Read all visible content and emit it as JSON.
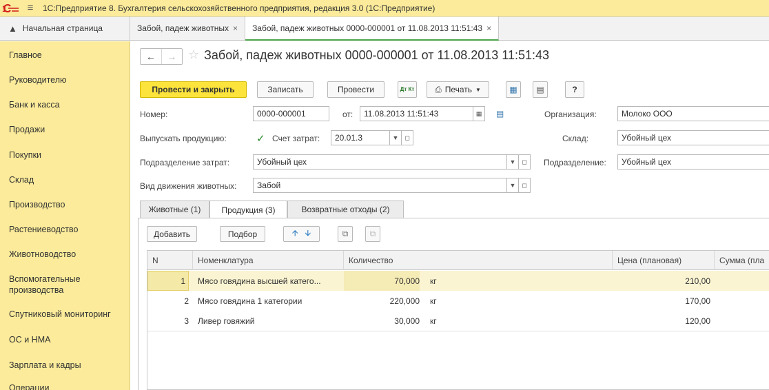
{
  "window": {
    "title": "1С:Предприятие 8. Бухгалтерия сельскохозяйственного предприятия, редакция 3.0  (1С:Предприятие)"
  },
  "tabs": [
    {
      "label": "Начальная страница"
    },
    {
      "label": "Забой, падеж животных",
      "close": "×"
    },
    {
      "label": "Забой, падеж животных 0000-000001 от 11.08.2013 11:51:43",
      "close": "×"
    }
  ],
  "sidebar": {
    "items": [
      {
        "label": "Главное"
      },
      {
        "label": "Руководителю"
      },
      {
        "label": "Банк и касса"
      },
      {
        "label": "Продажи"
      },
      {
        "label": "Покупки"
      },
      {
        "label": "Склад"
      },
      {
        "label": "Производство"
      },
      {
        "label": "Растениеводство"
      },
      {
        "label": "Животноводство"
      },
      {
        "label": "Вспомогательные производства"
      },
      {
        "label": "Спутниковый мониторинг"
      },
      {
        "label": "ОС и НМА"
      },
      {
        "label": "Зарплата и кадры"
      },
      {
        "label": "Операции"
      }
    ]
  },
  "document": {
    "title": "Забой, падеж животных 0000-000001 от 11.08.2013 11:51:43"
  },
  "toolbar": {
    "post_close": "Провести и закрыть",
    "save": "Записать",
    "post": "Провести",
    "dtkt": "Дт Кт",
    "print": "Печать",
    "help": "?"
  },
  "form": {
    "number_label": "Номер:",
    "number_value": "0000-000001",
    "date_label": "от:",
    "date_value": "11.08.2013 11:51:43",
    "org_label": "Организация:",
    "org_value": "Молоко ООО",
    "produce_label": "Выпускать продукцию:",
    "produce_checked": true,
    "cost_account_label": "Счет затрат:",
    "cost_account_value": "20.01.3",
    "warehouse_label": "Склад:",
    "warehouse_value": "Убойный цех",
    "cost_dept_label": "Подразделение затрат:",
    "cost_dept_value": "Убойный цех",
    "dept_label": "Подразделение:",
    "dept_value": "Убойный цех",
    "movement_label": "Вид движения животных:",
    "movement_value": "Забой"
  },
  "inner_tabs": [
    {
      "label": "Животные (1)"
    },
    {
      "label": "Продукция (3)"
    },
    {
      "label": "Возвратные отходы (2)"
    }
  ],
  "table_toolbar": {
    "add": "Добавить",
    "pick": "Подбор"
  },
  "table": {
    "columns": [
      "N",
      "Номенклатура",
      "Количество",
      "Цена (плановая)",
      "Сумма (пла"
    ],
    "rows": [
      {
        "n": "1",
        "item": "Мясо говядина высшей катего...",
        "qty": "70,000",
        "unit": "кг",
        "price": "210,00"
      },
      {
        "n": "2",
        "item": "Мясо говядина 1 категории",
        "qty": "220,000",
        "unit": "кг",
        "price": "170,00"
      },
      {
        "n": "3",
        "item": "Ливер говяжий",
        "qty": "30,000",
        "unit": "кг",
        "price": "120,00"
      }
    ]
  },
  "colors": {
    "sidebar_bg": "#fbeb9a",
    "primary_button": "#fce43c",
    "active_tab_underline": "#4aa34a",
    "selected_row": "#fbf4d2"
  }
}
